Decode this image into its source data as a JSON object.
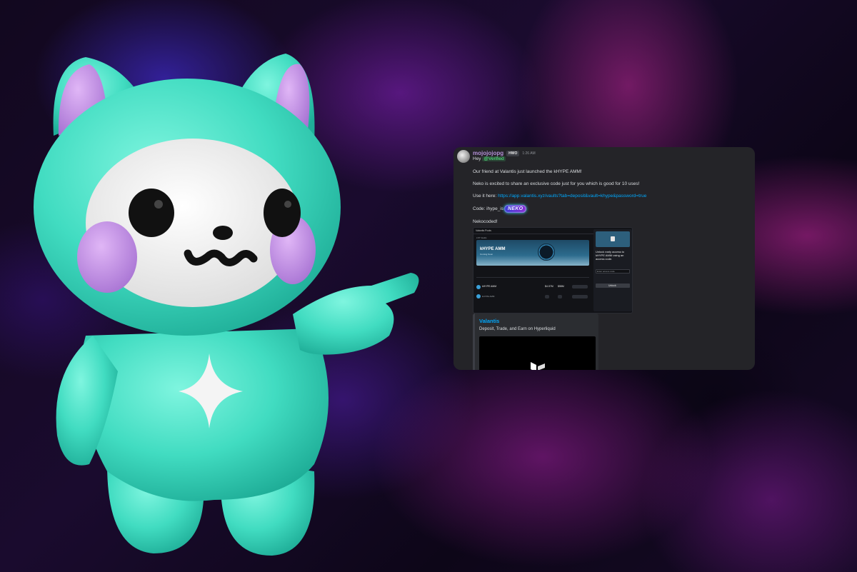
{
  "message": {
    "username": "mojojojopg",
    "server_tag": "HWO",
    "timestamp": "1:26 AM",
    "greeting": "Hey",
    "mention": "@Verified",
    "line1": "Our friend at Valantis just launched the kHYPE AMM!",
    "line2": "Neko is excited to share an exclusive code just for you which is good for 10 uses!",
    "line3_prefix": "Use it here:",
    "link": "https://app.valantis.xyz/vaults?tab=deposit&vault=khype&password=true",
    "code_prefix": "Code: ihype_is",
    "code_badge": "NEKO",
    "signoff": "Nekocoded!"
  },
  "embed_screenshot": {
    "brand": "Valantis Pools",
    "stat1_value": "$10.0M",
    "stat2_value": "$441.0M",
    "section_label": "LST Vaults",
    "banner_title": "kHYPE AMM",
    "banner_sub": "Coming Soon",
    "row1_name": "kHYPE AMM",
    "row1_val1": "$4.07M",
    "row1_val2": "$58M",
    "row2_name": "kHYPE AMM",
    "side_text": "Unlock early access to kHYPE AMM using an access code.",
    "side_input_placeholder": "Enter access code",
    "side_button": "Unlock"
  },
  "link_preview": {
    "site": "Valantis",
    "description": "Deposit, Trade, and Earn on Hyperliquid"
  },
  "colors": {
    "card_bg": "#242428",
    "username": "#b38fd6",
    "link": "#00a8fc",
    "mascot": "#4fe0c6",
    "mascot_accent": "#c79be8"
  }
}
